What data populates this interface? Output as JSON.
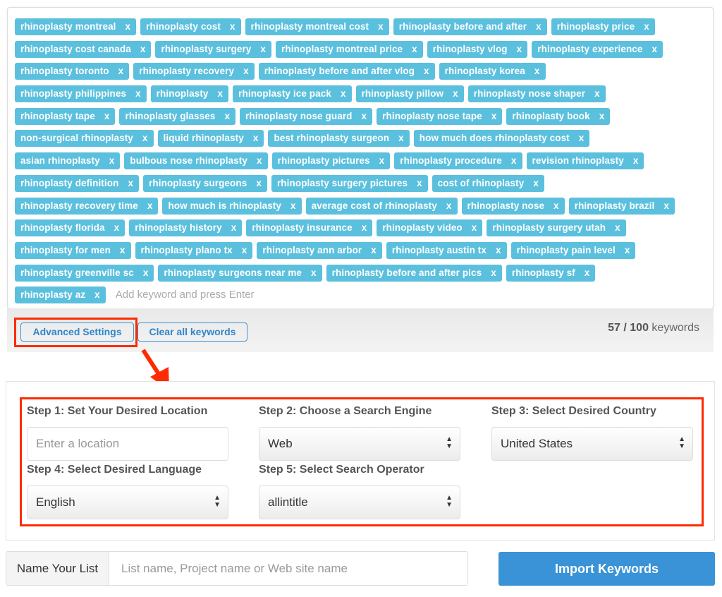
{
  "keywords_rows": [
    [
      "rhinoplasty montreal",
      "rhinoplasty cost",
      "rhinoplasty montreal cost",
      "rhinoplasty before and after",
      "rhinoplasty price"
    ],
    [
      "rhinoplasty cost canada",
      "rhinoplasty surgery",
      "rhinoplasty montreal price",
      "rhinoplasty vlog",
      "rhinoplasty experience"
    ],
    [
      "rhinoplasty toronto",
      "rhinoplasty recovery",
      "rhinoplasty before and after vlog",
      "rhinoplasty korea"
    ],
    [
      "rhinoplasty philippines",
      "rhinoplasty",
      "rhinoplasty ice pack",
      "rhinoplasty pillow",
      "rhinoplasty nose shaper"
    ],
    [
      "rhinoplasty tape",
      "rhinoplasty glasses",
      "rhinoplasty nose guard",
      "rhinoplasty nose tape",
      "rhinoplasty book"
    ],
    [
      "non-surgical rhinoplasty",
      "liquid rhinoplasty",
      "best rhinoplasty surgeon",
      "how much does rhinoplasty cost"
    ],
    [
      "asian rhinoplasty",
      "bulbous nose rhinoplasty",
      "rhinoplasty pictures",
      "rhinoplasty procedure",
      "revision rhinoplasty"
    ],
    [
      "rhinoplasty definition",
      "rhinoplasty surgeons",
      "rhinoplasty surgery pictures",
      "cost of rhinoplasty"
    ],
    [
      "rhinoplasty recovery time",
      "how much is rhinoplasty",
      "average cost of rhinoplasty",
      "rhinoplasty nose",
      "rhinoplasty brazil"
    ],
    [
      "rhinoplasty florida",
      "rhinoplasty history",
      "rhinoplasty insurance",
      "rhinoplasty video",
      "rhinoplasty surgery utah"
    ],
    [
      "rhinoplasty for men",
      "rhinoplasty plano tx",
      "rhinoplasty ann arbor",
      "rhinoplasty austin tx",
      "rhinoplasty pain level"
    ],
    [
      "rhinoplasty greenville sc",
      "rhinoplasty surgeons near me",
      "rhinoplasty before and after pics",
      "rhinoplasty sf"
    ],
    [
      "rhinoplasty az"
    ]
  ],
  "tag_remove": "x",
  "add_placeholder": "Add keyword and press Enter",
  "toolbar": {
    "advanced": "Advanced Settings",
    "clear": "Clear all keywords",
    "count": "57 / 100",
    "count_suffix": " keywords"
  },
  "settings": {
    "step1": "Step 1: Set Your Desired Location",
    "location_placeholder": "Enter a location",
    "step2": "Step 2: Choose a Search Engine",
    "engine": "Web",
    "step3": "Step 3: Select Desired Country",
    "country": "United States",
    "step4": "Step 4: Select Desired Language",
    "language": "English",
    "step5": "Step 5: Select Search Operator",
    "operator": "allintitle"
  },
  "bottom": {
    "name_label": "Name Your List",
    "name_placeholder": "List name, Project name or Web site name",
    "import": "Import Keywords"
  },
  "colors": {
    "tag": "#5bc0de",
    "primary": "#3a93d6",
    "highlight": "#ff2a00"
  }
}
